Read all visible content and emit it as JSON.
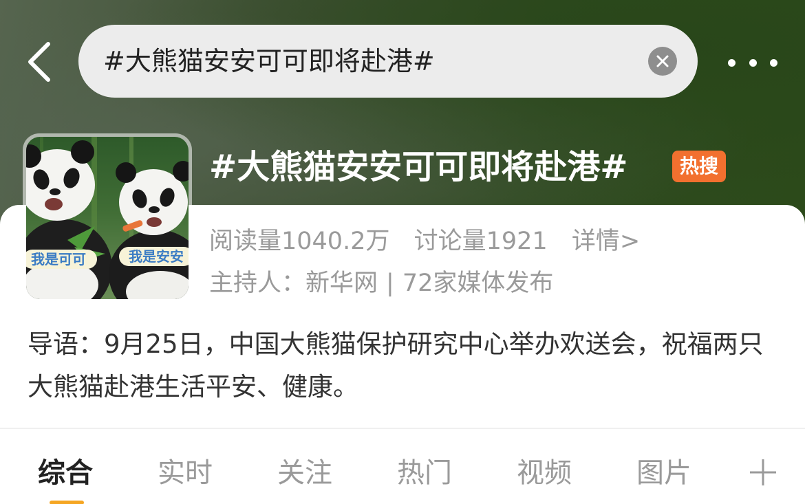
{
  "header": {
    "search_query": "#大熊猫安安可可即将赴港#"
  },
  "topic": {
    "title": "#大熊猫安安可可即将赴港#",
    "badge": "热搜",
    "reads": "阅读量1040.2万",
    "discussions": "讨论量1921",
    "detail_link": "详情>",
    "host_label": "主持人：新华网",
    "separator": "|",
    "media_count": "72家媒体发布",
    "avatar_left_sign": "我是可可",
    "avatar_right_sign": "我是安安"
  },
  "intro": {
    "text": "导语：9月25日，中国大熊猫保护研究中心举办欢送会，祝福两只大熊猫赴港生活平安、健康。"
  },
  "tabs": [
    {
      "label": "综合",
      "active": true
    },
    {
      "label": "实时",
      "active": false
    },
    {
      "label": "关注",
      "active": false
    },
    {
      "label": "热门",
      "active": false
    },
    {
      "label": "视频",
      "active": false
    },
    {
      "label": "图片",
      "active": false
    }
  ],
  "colors": {
    "badge": "#f2702f",
    "tab_indicator": "#f5a623",
    "muted_text": "#9a9a9a"
  },
  "icons": [
    "back-arrow-icon",
    "clear-icon",
    "more-icon",
    "plus-icon"
  ]
}
